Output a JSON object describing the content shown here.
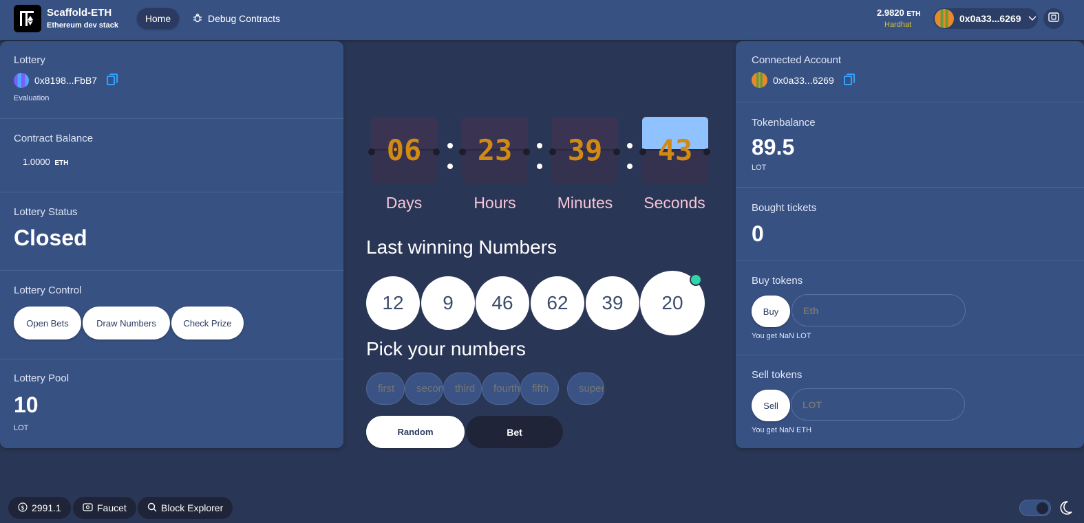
{
  "header": {
    "brand_title": "Scaffold-ETH",
    "brand_subtitle": "Ethereum dev stack",
    "nav_home": "Home",
    "nav_debug": "Debug Contracts",
    "eth_balance": "2.9820",
    "eth_unit": "ETH",
    "network": "Hardhat",
    "account": "0x0a33...6269"
  },
  "lottery": {
    "label": "Lottery",
    "address": "0x8198...FbB7",
    "sub": "Evaluation",
    "contract_balance_label": "Contract Balance",
    "contract_balance": "1.0000",
    "contract_balance_unit": "ETH",
    "status_label": "Lottery Status",
    "status": "Closed",
    "control_label": "Lottery Control",
    "btn_open": "Open Bets",
    "btn_draw": "Draw Numbers",
    "btn_check": "Check Prize",
    "pool_label": "Lottery Pool",
    "pool": "10",
    "pool_unit": "LOT"
  },
  "countdown": {
    "days": "06",
    "hours": "23",
    "minutes": "39",
    "seconds": "43",
    "days_label": "Days",
    "hours_label": "Hours",
    "minutes_label": "Minutes",
    "seconds_label": "Seconds"
  },
  "winning": {
    "heading": "Last winning Numbers",
    "numbers": [
      "12",
      "9",
      "46",
      "62",
      "39",
      "20"
    ]
  },
  "pick": {
    "heading": "Pick your numbers",
    "placeholders": [
      "first",
      "second",
      "third",
      "fourth",
      "fifth",
      "super"
    ],
    "btn_random": "Random",
    "btn_bet": "Bet"
  },
  "account": {
    "connected_label": "Connected Account",
    "address": "0x0a33...6269",
    "token_label": "Tokenbalance",
    "token_balance": "89.5",
    "token_unit": "LOT",
    "tickets_label": "Bought tickets",
    "tickets": "0",
    "buy_label": "Buy tokens",
    "buy_btn": "Buy",
    "buy_placeholder": "Eth",
    "buy_hint": "You get NaN LOT",
    "sell_label": "Sell tokens",
    "sell_btn": "Sell",
    "sell_placeholder": "LOT",
    "sell_hint": "You get NaN ETH"
  },
  "footer": {
    "price": "2991.1",
    "faucet": "Faucet",
    "explorer": "Block Explorer"
  }
}
